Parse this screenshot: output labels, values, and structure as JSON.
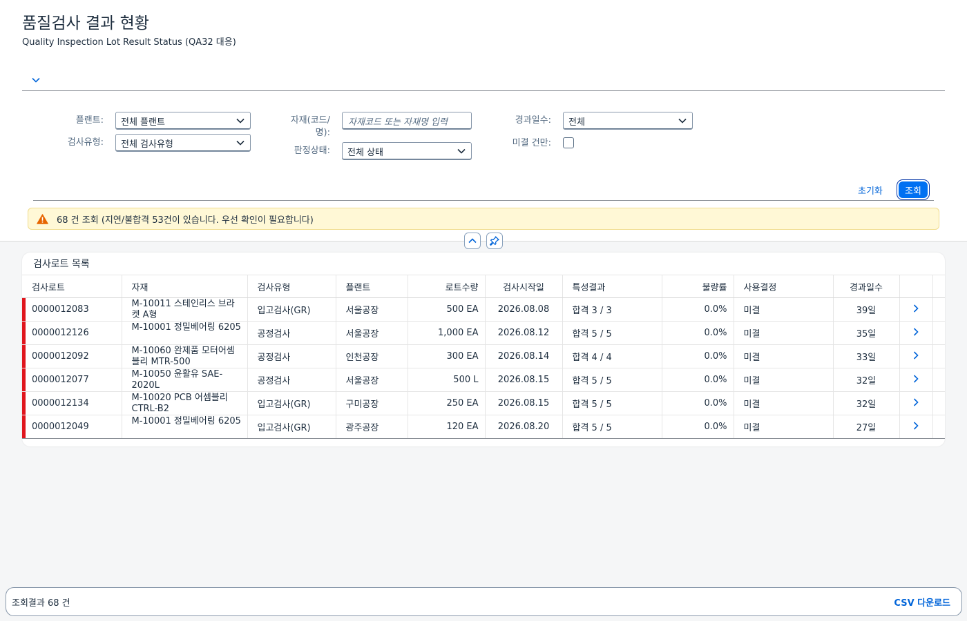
{
  "page": {
    "title": "품질검사 결과 현황",
    "subtitle": "Quality Inspection Lot Result Status (QA32 대응)"
  },
  "filters": {
    "plant_label": "플랜트:",
    "plant_value": "전체 플랜트",
    "insp_type_label": "검사유형:",
    "insp_type_value": "전체 검사유형",
    "material_label_1": "자재(코드/",
    "material_label_2": "명):",
    "material_placeholder": "자재코드 또는 자재명 입력",
    "decision_label": "판정상태:",
    "decision_value": "전체 상태",
    "elapsed_label": "경과일수:",
    "elapsed_value": "전체",
    "open_only_label": "미결 건만:",
    "open_only_checked": false,
    "reset_label": "초기화",
    "search_label": "조회"
  },
  "message": {
    "text": "68 건 조회 (지연/불합격 53건이 있습니다. 우선 확인이 필요합니다)",
    "level": "warning",
    "color": "#e76500"
  },
  "table": {
    "title": "검사로트 목록",
    "columns": [
      "검사로트",
      "자재",
      "검사유형",
      "플랜트",
      "로트수량",
      "검사시작일",
      "특성결과",
      "불량률",
      "사용결정",
      "경과일수"
    ],
    "rows": [
      {
        "lot": "0000012083",
        "material": "M-10011 스테인리스 브라켓 A형",
        "type": "입고검사(GR)",
        "plant": "서울공장",
        "qty": "500 EA",
        "start": "2026.08.08",
        "result": "합격 3 / 3",
        "defect": "0.0%",
        "decision": "미결",
        "elapsed": "39일"
      },
      {
        "lot": "0000012126",
        "material": "M-10001 정밀베어링 6205",
        "type": "공정검사",
        "plant": "서울공장",
        "qty": "1,000 EA",
        "start": "2026.08.12",
        "result": "합격 5 / 5",
        "defect": "0.0%",
        "decision": "미결",
        "elapsed": "35일"
      },
      {
        "lot": "0000012092",
        "material": "M-10060 완제품 모터어셈블리 MTR-500",
        "type": "공정검사",
        "plant": "인천공장",
        "qty": "300 EA",
        "start": "2026.08.14",
        "result": "합격 4 / 4",
        "defect": "0.0%",
        "decision": "미결",
        "elapsed": "33일"
      },
      {
        "lot": "0000012077",
        "material": "M-10050 윤활유 SAE-2020L",
        "type": "공정검사",
        "plant": "서울공장",
        "qty": "500 L",
        "start": "2026.08.15",
        "result": "합격 5 / 5",
        "defect": "0.0%",
        "decision": "미결",
        "elapsed": "32일"
      },
      {
        "lot": "0000012134",
        "material": "M-10020 PCB 어셈블리 CTRL-B2",
        "type": "입고검사(GR)",
        "plant": "구미공장",
        "qty": "250 EA",
        "start": "2026.08.15",
        "result": "합격 5 / 5",
        "defect": "0.0%",
        "decision": "미결",
        "elapsed": "32일"
      },
      {
        "lot": "0000012049",
        "material": "M-10001 정밀베어링 6205",
        "type": "입고검사(GR)",
        "plant": "광주공장",
        "qty": "120 EA",
        "start": "2026.08.20",
        "result": "합격 5 / 5",
        "defect": "0.0%",
        "decision": "미결",
        "elapsed": "27일"
      }
    ],
    "row_status_color": "#e0161e"
  },
  "footer": {
    "count_text": "조회결과 68 건",
    "csv_label": "CSV 다운로드"
  },
  "icons": {
    "expand": "chevron-down-icon",
    "warning": "warning-icon",
    "collapse": "chevron-up-icon",
    "pin": "pin-icon",
    "row_nav": "chevron-right-icon"
  }
}
